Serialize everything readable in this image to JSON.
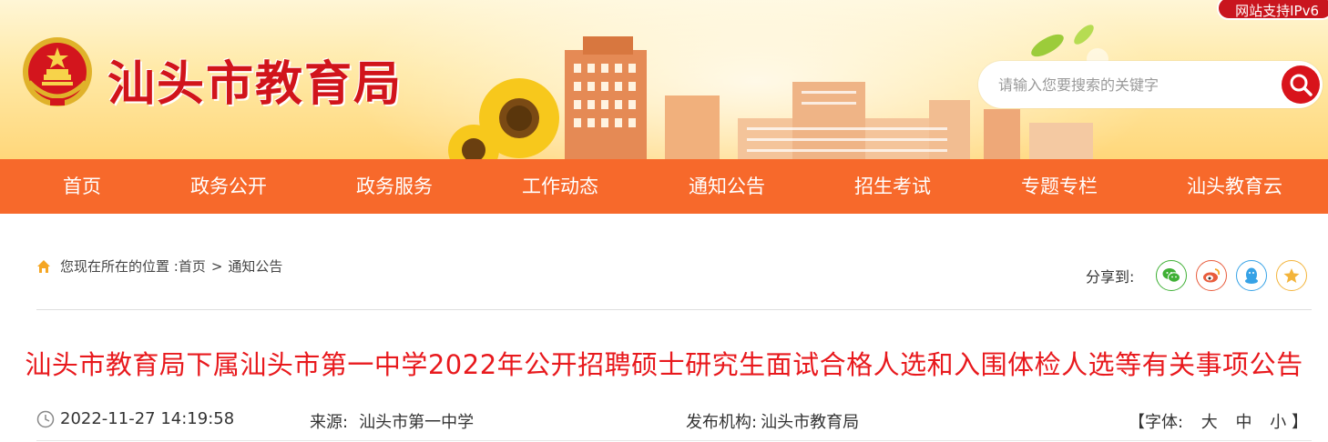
{
  "header": {
    "site_title": "汕头市教育局",
    "ipv6_badge": "网站支持IPv6",
    "search": {
      "placeholder": "请输入您要搜索的关键字"
    },
    "emblem_icon": "national-emblem-icon",
    "search_icon": "search-icon"
  },
  "nav": {
    "items": [
      {
        "label": "首页"
      },
      {
        "label": "政务公开"
      },
      {
        "label": "政务服务"
      },
      {
        "label": "工作动态"
      },
      {
        "label": "通知公告"
      },
      {
        "label": "招生考试"
      },
      {
        "label": "专题专栏"
      },
      {
        "label": "汕头教育云"
      }
    ]
  },
  "breadcrumb": {
    "prefix": "您现在所在的位置 : ",
    "home": "首页",
    "separator": ">",
    "current": "通知公告",
    "icon": "home-icon"
  },
  "share": {
    "label": "分享到:",
    "targets": [
      {
        "name": "wechat",
        "icon": "wechat-icon",
        "color": "#3fb035"
      },
      {
        "name": "weibo",
        "icon": "weibo-icon",
        "color": "#e85c3c"
      },
      {
        "name": "qq",
        "icon": "qq-icon",
        "color": "#36a2e6"
      },
      {
        "name": "qzone",
        "icon": "qzone-icon",
        "color": "#f3b43b"
      }
    ]
  },
  "article": {
    "title": "汕头市教育局下属汕头市第一中学2022年公开招聘硕士研究生面试合格人选和入围体检人选等有关事项公告",
    "published_at": "2022-11-27 14:19:58",
    "source_label": "来源:",
    "source": "汕头市第一中学",
    "publisher_label": "发布机构:",
    "publisher": "汕头市教育局",
    "font_size_label": "【字体:",
    "font_sizes": [
      "大",
      "中",
      "小"
    ],
    "font_size_close": "】"
  },
  "colors": {
    "brand_red": "#d1141b",
    "nav_orange": "#f7692b",
    "title_red": "#e8191d"
  }
}
